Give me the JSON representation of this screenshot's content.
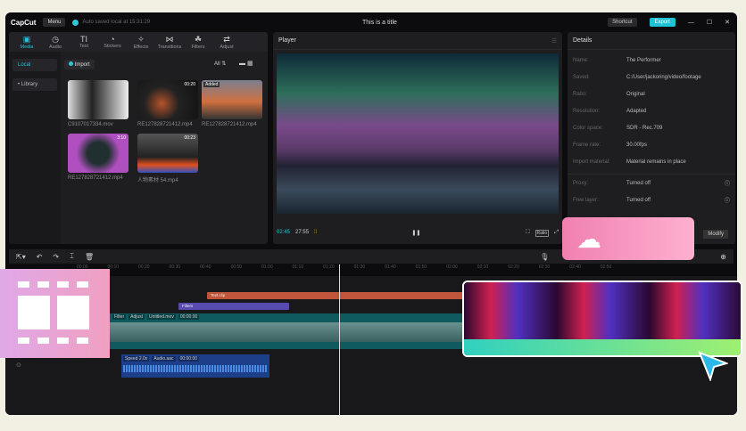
{
  "app": {
    "logo": "CapCut",
    "menu": "Menu",
    "autosave": "Auto saved local at 15:31:29",
    "title": "This is a title",
    "shortcut": "Shortcut",
    "export": "Export"
  },
  "tools": [
    {
      "label": "Media",
      "icon": "▣"
    },
    {
      "label": "Audio",
      "icon": "◷"
    },
    {
      "label": "Text",
      "icon": "TI"
    },
    {
      "label": "Stickers",
      "icon": "◔"
    },
    {
      "label": "Effects",
      "icon": "✧"
    },
    {
      "label": "Transitions",
      "icon": "⋈"
    },
    {
      "label": "Filters",
      "icon": "☘"
    },
    {
      "label": "Adjust",
      "icon": "⇄"
    }
  ],
  "sidebar": {
    "local": "Local",
    "library": "• Library"
  },
  "media": {
    "import": "Import",
    "sort": "All ⇅",
    "items": [
      {
        "name": "C9107017334.mov",
        "duration": ""
      },
      {
        "name": "RE12782872141​2.mp4",
        "duration": "00:20"
      },
      {
        "name": "RE12782872141​2.mp4",
        "duration": "",
        "badge": "Added"
      },
      {
        "name": "RE12782872141​2.mp4",
        "duration": "3:10"
      },
      {
        "name": "人物素材 54.mp4",
        "duration": "00:23"
      }
    ]
  },
  "player": {
    "title": "Player",
    "current": "02:45",
    "total": "27:55",
    "ratio": "Ratio"
  },
  "details": {
    "title": "Details",
    "rows": [
      {
        "k": "Name:",
        "v": "The Performer"
      },
      {
        "k": "Saved:",
        "v": "C:/User/jackoring/video/footage"
      },
      {
        "k": "Ratio:",
        "v": "Original"
      },
      {
        "k": "Resolution:",
        "v": "Adapted"
      },
      {
        "k": "Color space:",
        "v": "SDR - Rec.709"
      },
      {
        "k": "Frame rate:",
        "v": "30.00fps"
      },
      {
        "k": "Import material:",
        "v": "Material remains in place"
      }
    ],
    "rows2": [
      {
        "k": "Proxy:",
        "v": "Turned off"
      },
      {
        "k": "Free layer:",
        "v": "Turned off"
      }
    ],
    "modify": "Modify"
  },
  "timeline": {
    "ticks": [
      "00:00",
      "00:10",
      "00:20",
      "00:30",
      "00:40",
      "00:50",
      "01:00",
      "01:10",
      "01:20",
      "01:30",
      "01:40",
      "01:50",
      "02:00",
      "02:10",
      "02:20",
      "02:30",
      "02:40",
      "02:50"
    ],
    "text_clip": "Text clip",
    "filter_clip": "Filters",
    "video_tags": [
      "Filter",
      "Adjust",
      "Untitled.mov",
      "00:00:00"
    ],
    "audio_tags": [
      "Speed 2.0x",
      "Audio.aac",
      "00:00:00"
    ]
  },
  "colors": {
    "accent": "#1fc3d6",
    "text_clip": "#c0553a",
    "filter_clip": "#5a4bb0",
    "video": "#0e5a5e",
    "audio": "#1d3f8a"
  }
}
